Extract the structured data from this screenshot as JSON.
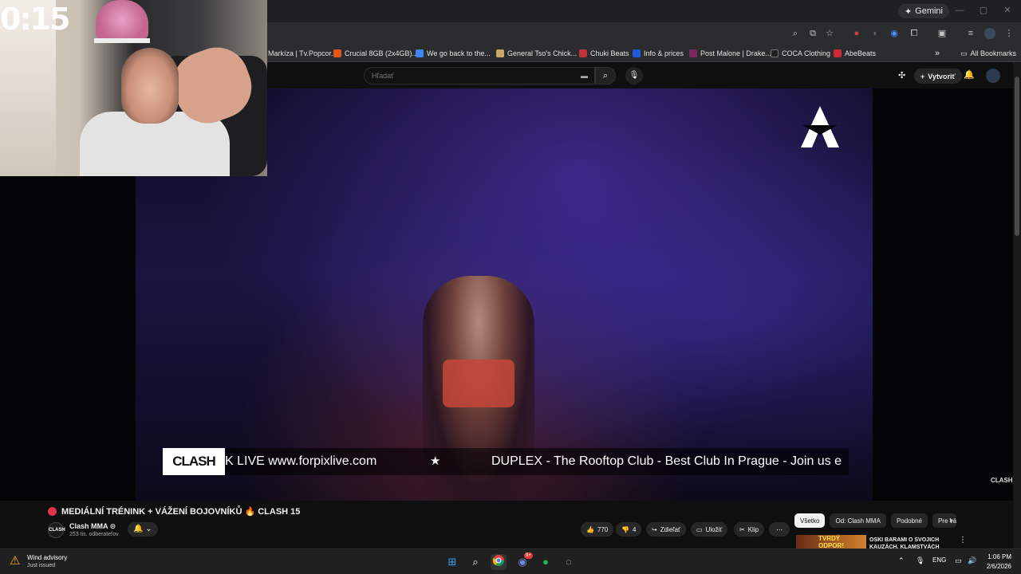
{
  "overlay": {
    "timer": "0:15"
  },
  "browser": {
    "gemini_label": "Gemini",
    "bookmarks": [
      {
        "label": "Markíza | Tv.Popcor...",
        "color": "#3a3a3a"
      },
      {
        "label": "Crucial 8GB (2x4GB)...",
        "color": "#e2571e"
      },
      {
        "label": "We go back to the...",
        "color": "#4285f4"
      },
      {
        "label": "General Tso's Chick...",
        "color": "#c9a76a"
      },
      {
        "label": "Chuki Beats",
        "color": "#c0323a"
      },
      {
        "label": "Info & prices",
        "color": "#1f5bd6"
      },
      {
        "label": "Post Malone | Drake...",
        "color": "#7b2a5e"
      },
      {
        "label": "COCA Clothing",
        "color": "#222222"
      },
      {
        "label": "AbeBeats",
        "color": "#d0283a"
      }
    ],
    "all_bookmarks": "All Bookmarks"
  },
  "youtube": {
    "search_placeholder": "Hľadať",
    "create_label": "Vytvoriť",
    "ticker_text_1": "K LIVE www.forpixlive.com",
    "ticker_text_2": "DUPLEX - The Rooftop Club - Best Club In Prague - Join us e",
    "ticker_logo": "CLASH",
    "watermark": "CLASH",
    "video_title": "MEDIÁLNÍ TRÉNINK + VÁŽENÍ BOJOVNÍKŮ 🔥 CLASH 15",
    "channel_name": "Clash MMA ⊙",
    "channel_avatar": "CLASH",
    "subscribers": "253 tis. odberateľov",
    "likes": "770",
    "dislikes": "4",
    "share_label": "Zdieľať",
    "save_label": "Uložiť",
    "clip_label": "Klip",
    "filters": [
      "Všetko",
      "Od: Clash MMA",
      "Podobné",
      "Pre vás"
    ],
    "rec_thumb_text": "TVRDÝ ODPOR!",
    "rec_title": "OSKI BARAMI O SVOJICH KAUZÁCH, KLAMSTVÁCH"
  },
  "taskbar": {
    "weather_title": "Wind advisory",
    "weather_sub": "Just issued",
    "lang": "ENG",
    "time": "1:06 PM",
    "date": "2/6/2026",
    "discord_badge": "9+"
  }
}
